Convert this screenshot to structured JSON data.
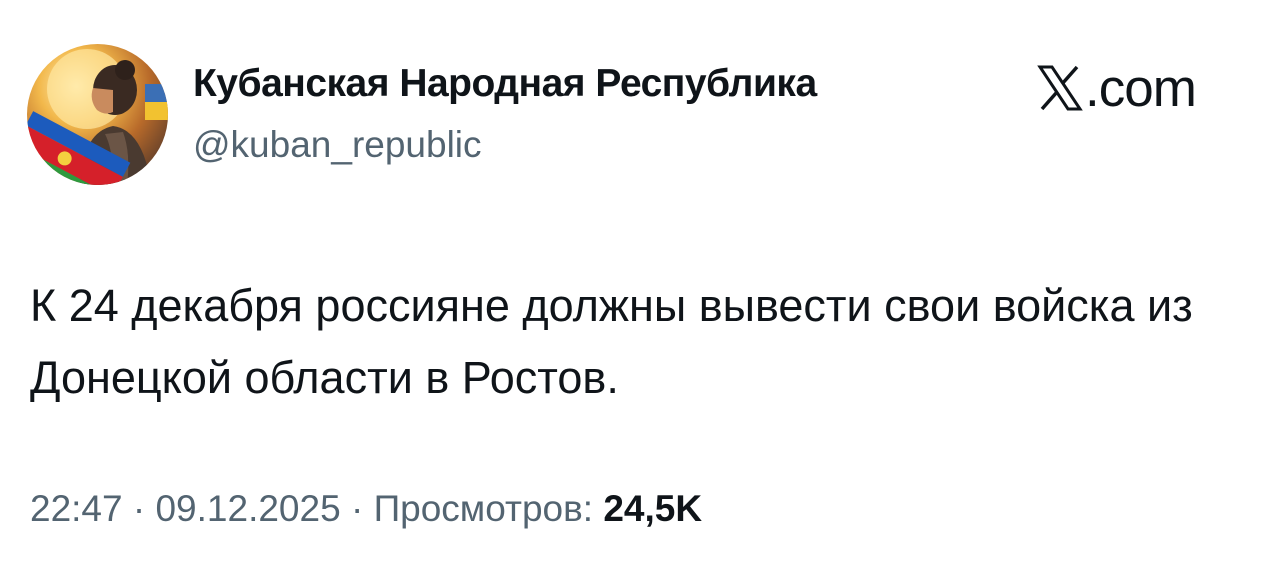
{
  "author": {
    "display_name": "Кубанская Народная Республика",
    "handle": "@kuban_republic"
  },
  "brand": {
    "domain": ".com",
    "logo_icon": "x-logo-icon"
  },
  "tweet": {
    "text": "К 24 декабря россияне должны вывести свои войска из Донецкой области в Ростов."
  },
  "meta": {
    "time": "22:47",
    "separator": "·",
    "date": "09.12.2025",
    "views_label": "Просмотров:",
    "views_count": "24,5K"
  },
  "colors": {
    "text_primary": "#0f1419",
    "text_secondary": "#536471",
    "background": "#ffffff"
  }
}
